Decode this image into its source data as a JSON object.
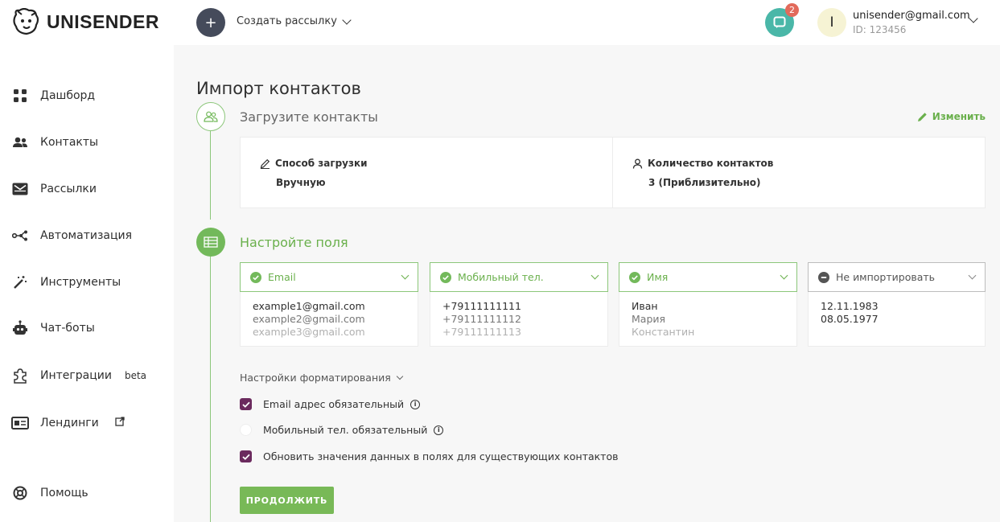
{
  "header": {
    "brand": "UNISENDER",
    "create_label": "Создать рассылку",
    "notifications_count": "2",
    "avatar_letter": "I",
    "user_email": "unisender@gmail.com",
    "user_id": "ID: 123456"
  },
  "sidebar": {
    "items": [
      {
        "label": "Дашборд",
        "icon": "dashboard-icon"
      },
      {
        "label": "Контакты",
        "icon": "contacts-icon"
      },
      {
        "label": "Рассылки",
        "icon": "mail-icon"
      },
      {
        "label": "Автоматизация",
        "icon": "automation-icon"
      },
      {
        "label": "Инструменты",
        "icon": "magic-wand-icon"
      },
      {
        "label": "Чат-боты",
        "icon": "robot-icon"
      },
      {
        "label": "Интеграции",
        "icon": "puzzle-icon",
        "badge": "beta"
      },
      {
        "label": "Лендинги",
        "icon": "landing-icon"
      },
      {
        "label": "Помощь",
        "icon": "help-icon"
      }
    ]
  },
  "main": {
    "title": "Импорт контактов",
    "step1": {
      "title": "Загрузите контакты",
      "edit_label": "Изменить",
      "method_label": "Способ загрузки",
      "method_value": "Вручную",
      "count_label": "Количество контактов",
      "count_value": "3 (Приблизительно)"
    },
    "step2": {
      "title": "Настройте поля",
      "columns": [
        {
          "header": "Email",
          "rows": [
            "example1@gmail.com",
            "example2@gmail.com",
            "example3@gmail.com"
          ]
        },
        {
          "header": "Мобильный тел.",
          "rows": [
            "+79111111111",
            "+79111111112",
            "+79111111113"
          ]
        },
        {
          "header": "Имя",
          "rows": [
            "Иван",
            "Мария",
            "Константин"
          ]
        },
        {
          "header": "Не импортировать",
          "rows": [
            "12.11.1983",
            "08.05.1977",
            ""
          ]
        }
      ],
      "format_toggle": "Настройки форматирования",
      "options": [
        {
          "label": "Email адрес обязательный",
          "checked": true
        },
        {
          "label": "Мобильный тел. обязательный",
          "checked": false
        },
        {
          "label": "Обновить значения данных в полях для существующих контактов",
          "checked": true
        }
      ],
      "continue_label": "ПРОДОЛЖИТЬ"
    }
  },
  "colors": {
    "accent_green": "#73b95b",
    "checkbox_purple": "#6b2a5e",
    "notif_teal": "#4ab7a8",
    "badge_red": "#e26a5b",
    "create_btn": "#454b5b"
  }
}
